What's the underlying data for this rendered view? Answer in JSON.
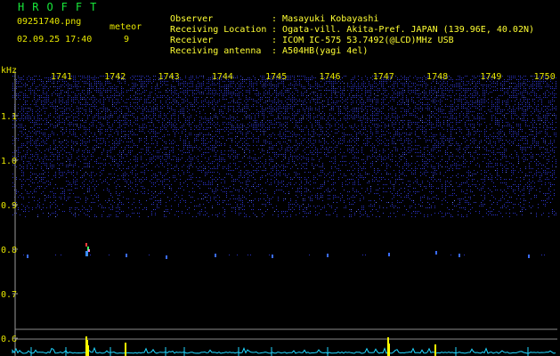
{
  "header": {
    "app_title": "HROFFT",
    "file_name": "09251740.png",
    "datetime": "02.09.25 17:40",
    "meteor_label": "meteor",
    "meteor_count": "9"
  },
  "station": {
    "observer_label": "Observer",
    "observer_value": "Masayuki Kobayashi",
    "location_label": "Receiving Location",
    "location_value": "Ogata-vill. Akita-Pref. JAPAN (139.96E, 40.02N)",
    "receiver_label": "Receiver",
    "receiver_value": "ICOM IC-575 53.7492(@LCD)MHz USB",
    "antenna_label": "Receiving antenna",
    "antenna_value": "A504HB(yagi 4el)"
  },
  "spectrogram": {
    "y_unit": "kHz",
    "time_ticks": [
      "1741",
      "1742",
      "1743",
      "1744",
      "1745",
      "1746",
      "1747",
      "1748",
      "1749",
      "1750"
    ],
    "freq_ticks": [
      "1.1",
      "1.0",
      "0.9",
      "0.8",
      "0.7",
      "0.6"
    ],
    "colors": {
      "background": "#000000",
      "noise": "#2a32c8",
      "text": "#e6e600",
      "ping": "#3a6cff",
      "power_trace": "#1fd6ff",
      "power_peak": "#ffff00"
    }
  }
}
